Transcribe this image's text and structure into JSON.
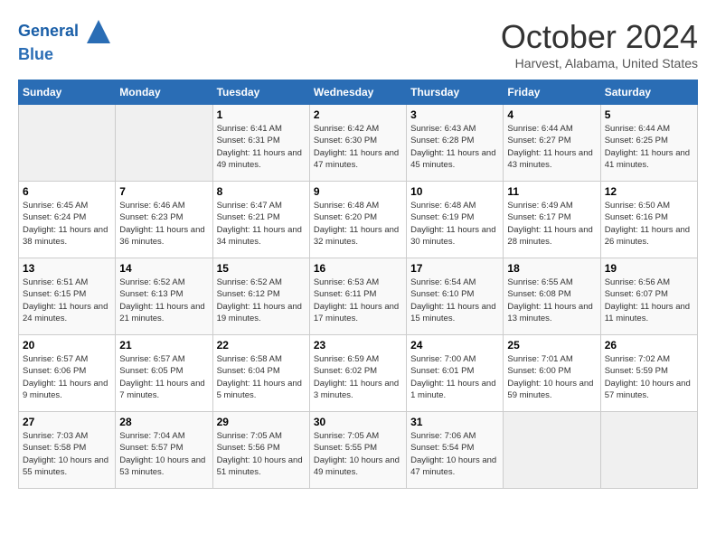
{
  "header": {
    "logo_line1": "General",
    "logo_line2": "Blue",
    "month": "October 2024",
    "location": "Harvest, Alabama, United States"
  },
  "days_of_week": [
    "Sunday",
    "Monday",
    "Tuesday",
    "Wednesday",
    "Thursday",
    "Friday",
    "Saturday"
  ],
  "weeks": [
    [
      {
        "day": "",
        "info": ""
      },
      {
        "day": "",
        "info": ""
      },
      {
        "day": "1",
        "sunrise": "Sunrise: 6:41 AM",
        "sunset": "Sunset: 6:31 PM",
        "daylight": "Daylight: 11 hours and 49 minutes."
      },
      {
        "day": "2",
        "sunrise": "Sunrise: 6:42 AM",
        "sunset": "Sunset: 6:30 PM",
        "daylight": "Daylight: 11 hours and 47 minutes."
      },
      {
        "day": "3",
        "sunrise": "Sunrise: 6:43 AM",
        "sunset": "Sunset: 6:28 PM",
        "daylight": "Daylight: 11 hours and 45 minutes."
      },
      {
        "day": "4",
        "sunrise": "Sunrise: 6:44 AM",
        "sunset": "Sunset: 6:27 PM",
        "daylight": "Daylight: 11 hours and 43 minutes."
      },
      {
        "day": "5",
        "sunrise": "Sunrise: 6:44 AM",
        "sunset": "Sunset: 6:25 PM",
        "daylight": "Daylight: 11 hours and 41 minutes."
      }
    ],
    [
      {
        "day": "6",
        "sunrise": "Sunrise: 6:45 AM",
        "sunset": "Sunset: 6:24 PM",
        "daylight": "Daylight: 11 hours and 38 minutes."
      },
      {
        "day": "7",
        "sunrise": "Sunrise: 6:46 AM",
        "sunset": "Sunset: 6:23 PM",
        "daylight": "Daylight: 11 hours and 36 minutes."
      },
      {
        "day": "8",
        "sunrise": "Sunrise: 6:47 AM",
        "sunset": "Sunset: 6:21 PM",
        "daylight": "Daylight: 11 hours and 34 minutes."
      },
      {
        "day": "9",
        "sunrise": "Sunrise: 6:48 AM",
        "sunset": "Sunset: 6:20 PM",
        "daylight": "Daylight: 11 hours and 32 minutes."
      },
      {
        "day": "10",
        "sunrise": "Sunrise: 6:48 AM",
        "sunset": "Sunset: 6:19 PM",
        "daylight": "Daylight: 11 hours and 30 minutes."
      },
      {
        "day": "11",
        "sunrise": "Sunrise: 6:49 AM",
        "sunset": "Sunset: 6:17 PM",
        "daylight": "Daylight: 11 hours and 28 minutes."
      },
      {
        "day": "12",
        "sunrise": "Sunrise: 6:50 AM",
        "sunset": "Sunset: 6:16 PM",
        "daylight": "Daylight: 11 hours and 26 minutes."
      }
    ],
    [
      {
        "day": "13",
        "sunrise": "Sunrise: 6:51 AM",
        "sunset": "Sunset: 6:15 PM",
        "daylight": "Daylight: 11 hours and 24 minutes."
      },
      {
        "day": "14",
        "sunrise": "Sunrise: 6:52 AM",
        "sunset": "Sunset: 6:13 PM",
        "daylight": "Daylight: 11 hours and 21 minutes."
      },
      {
        "day": "15",
        "sunrise": "Sunrise: 6:52 AM",
        "sunset": "Sunset: 6:12 PM",
        "daylight": "Daylight: 11 hours and 19 minutes."
      },
      {
        "day": "16",
        "sunrise": "Sunrise: 6:53 AM",
        "sunset": "Sunset: 6:11 PM",
        "daylight": "Daylight: 11 hours and 17 minutes."
      },
      {
        "day": "17",
        "sunrise": "Sunrise: 6:54 AM",
        "sunset": "Sunset: 6:10 PM",
        "daylight": "Daylight: 11 hours and 15 minutes."
      },
      {
        "day": "18",
        "sunrise": "Sunrise: 6:55 AM",
        "sunset": "Sunset: 6:08 PM",
        "daylight": "Daylight: 11 hours and 13 minutes."
      },
      {
        "day": "19",
        "sunrise": "Sunrise: 6:56 AM",
        "sunset": "Sunset: 6:07 PM",
        "daylight": "Daylight: 11 hours and 11 minutes."
      }
    ],
    [
      {
        "day": "20",
        "sunrise": "Sunrise: 6:57 AM",
        "sunset": "Sunset: 6:06 PM",
        "daylight": "Daylight: 11 hours and 9 minutes."
      },
      {
        "day": "21",
        "sunrise": "Sunrise: 6:57 AM",
        "sunset": "Sunset: 6:05 PM",
        "daylight": "Daylight: 11 hours and 7 minutes."
      },
      {
        "day": "22",
        "sunrise": "Sunrise: 6:58 AM",
        "sunset": "Sunset: 6:04 PM",
        "daylight": "Daylight: 11 hours and 5 minutes."
      },
      {
        "day": "23",
        "sunrise": "Sunrise: 6:59 AM",
        "sunset": "Sunset: 6:02 PM",
        "daylight": "Daylight: 11 hours and 3 minutes."
      },
      {
        "day": "24",
        "sunrise": "Sunrise: 7:00 AM",
        "sunset": "Sunset: 6:01 PM",
        "daylight": "Daylight: 11 hours and 1 minute."
      },
      {
        "day": "25",
        "sunrise": "Sunrise: 7:01 AM",
        "sunset": "Sunset: 6:00 PM",
        "daylight": "Daylight: 10 hours and 59 minutes."
      },
      {
        "day": "26",
        "sunrise": "Sunrise: 7:02 AM",
        "sunset": "Sunset: 5:59 PM",
        "daylight": "Daylight: 10 hours and 57 minutes."
      }
    ],
    [
      {
        "day": "27",
        "sunrise": "Sunrise: 7:03 AM",
        "sunset": "Sunset: 5:58 PM",
        "daylight": "Daylight: 10 hours and 55 minutes."
      },
      {
        "day": "28",
        "sunrise": "Sunrise: 7:04 AM",
        "sunset": "Sunset: 5:57 PM",
        "daylight": "Daylight: 10 hours and 53 minutes."
      },
      {
        "day": "29",
        "sunrise": "Sunrise: 7:05 AM",
        "sunset": "Sunset: 5:56 PM",
        "daylight": "Daylight: 10 hours and 51 minutes."
      },
      {
        "day": "30",
        "sunrise": "Sunrise: 7:05 AM",
        "sunset": "Sunset: 5:55 PM",
        "daylight": "Daylight: 10 hours and 49 minutes."
      },
      {
        "day": "31",
        "sunrise": "Sunrise: 7:06 AM",
        "sunset": "Sunset: 5:54 PM",
        "daylight": "Daylight: 10 hours and 47 minutes."
      },
      {
        "day": "",
        "info": ""
      },
      {
        "day": "",
        "info": ""
      }
    ]
  ]
}
